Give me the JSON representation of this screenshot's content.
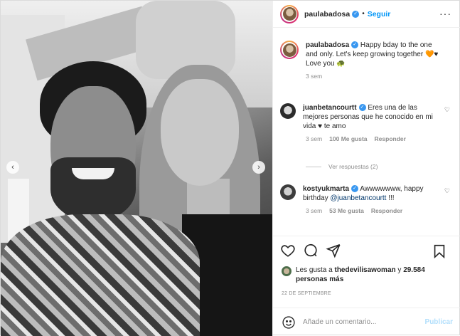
{
  "header": {
    "username": "paulabadosa",
    "follow_label": "Seguir",
    "more_label": "···"
  },
  "photo_nav": {
    "prev": "‹",
    "next": "›"
  },
  "caption": {
    "username": "paulabadosa",
    "text": "Happy bday to the one and only. Let's keep growing together 🧡♥ Love you 🐢",
    "time": "3 sem"
  },
  "comments": [
    {
      "username": "juanbetancourtt",
      "text": "Eres una de las mejores personas que he conocido en mi vida ♥ te amo",
      "time": "3 sem",
      "likes": "100 Me gusta",
      "reply_label": "Responder",
      "view_replies": "Ver respuestas (2)"
    },
    {
      "username": "kostyukmarta",
      "text_before": "Awwwwwww, happy birthday ",
      "mention": "@juanbetancourtt",
      "text_after": " !!!",
      "time": "3 sem",
      "likes": "53 Me gusta",
      "reply_label": "Responder"
    }
  ],
  "likes": {
    "prefix": "Les gusta a ",
    "user": "thedevilisawoman",
    "middle": " y ",
    "count": "29.584 personas más"
  },
  "date": "22 DE SEPTIEMBRE",
  "add_comment": {
    "placeholder": "Añade un comentario...",
    "publish_label": "Publicar"
  },
  "icons": {
    "heart": "heart-icon",
    "comment": "comment-icon",
    "share": "share-icon",
    "save": "bookmark-icon",
    "emoji": "emoji-icon"
  },
  "colors": {
    "link_blue": "#0095f6",
    "publish_disabled": "#b2dffc",
    "verified": "#3897f0",
    "muted": "#8e8e8e"
  }
}
